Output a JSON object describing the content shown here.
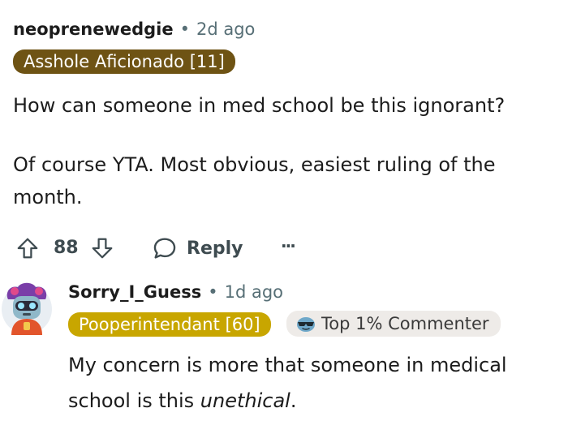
{
  "comment": {
    "username": "neoprenewedgie",
    "separator": "•",
    "time": "2d ago",
    "flair": "Asshole Aficionado [11]",
    "flair_color": "#6e5314",
    "body_line1": "How can someone in med school be this ignorant?",
    "body_line2": "Of course YTA. Most obvious, easiest ruling of the",
    "body_line3": "month.",
    "actions": {
      "upvote_icon": "arrow-up-icon",
      "score": "88",
      "downvote_icon": "arrow-down-icon",
      "reply_icon": "speech-bubble-icon",
      "reply_label": "Reply",
      "more_label": "···"
    }
  },
  "reply": {
    "avatar_icon": "robot-avatar-icon",
    "username": "Sorry_I_Guess",
    "separator": "•",
    "time": "1d ago",
    "flair": "Pooperintendant [60]",
    "flair_color": "#c8a600",
    "badge_icon": "sunglasses-emoji-icon",
    "badge_label": "Top 1% Commenter",
    "body_part1": "My concern is more that someone in medical",
    "body_part2": "school is this ",
    "body_italic": "unethical",
    "body_end": "."
  }
}
